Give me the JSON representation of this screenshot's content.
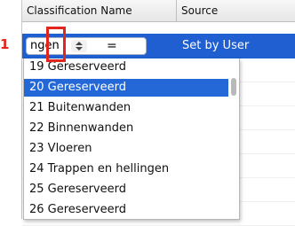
{
  "step_marker": "1",
  "table": {
    "columns": [
      "Classification Name",
      "Source"
    ],
    "active_row": {
      "combo_value": "ngen",
      "operator": "=",
      "source": "Set by User"
    }
  },
  "dropdown": {
    "options": [
      "19 Gereserveerd",
      "20 Gereserveerd",
      "21 Buitenwanden",
      "22 Binnenwanden",
      "23 Vloeren",
      "24 Trappen en hellingen",
      "25 Gereserveerd",
      "26 Gereserveerd"
    ],
    "selected": "20 Gereserveerd"
  },
  "colors": {
    "selection": "#2468d8",
    "annotation": "#e2261b"
  }
}
